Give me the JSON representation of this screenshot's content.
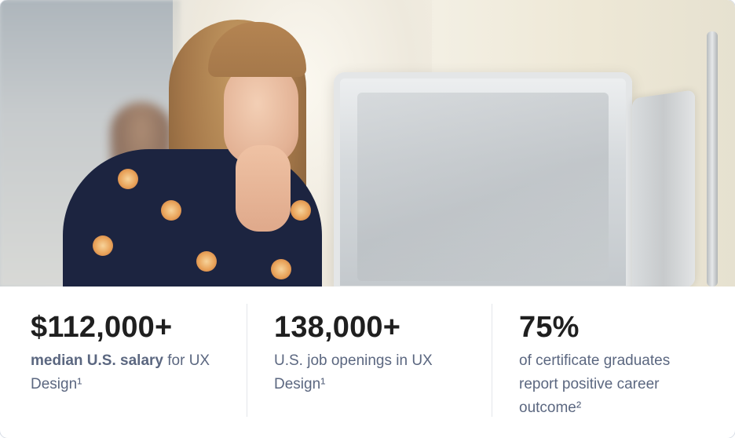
{
  "stats": [
    {
      "value": "$112,000+",
      "desc_bold": "median U.S. salary",
      "desc_rest": " for UX Design¹"
    },
    {
      "value": "138,000+",
      "desc_bold": "",
      "desc_rest": "U.S. job openings in UX Design¹"
    },
    {
      "value": "75%",
      "desc_bold": "",
      "desc_rest": "of certificate graduates report positive career outcome²"
    }
  ],
  "colors": {
    "value_text": "#1f1f1f",
    "desc_text": "#5b6780",
    "divider": "#e3e6ea"
  }
}
